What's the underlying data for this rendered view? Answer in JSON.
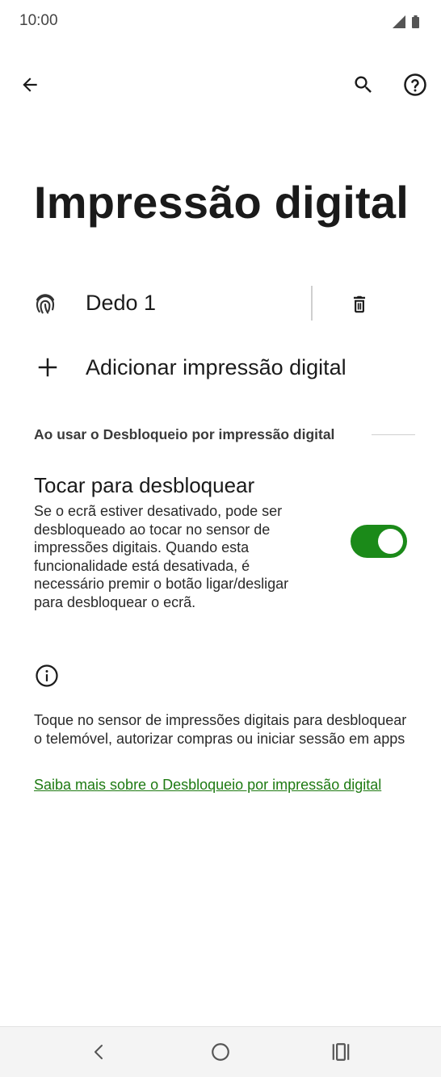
{
  "status_bar": {
    "time": "10:00",
    "icons": [
      "signal-icon",
      "battery-icon"
    ]
  },
  "app_bar": {
    "back_icon": "arrow-left-icon",
    "search_icon": "search-icon",
    "help_icon": "help-circle-icon"
  },
  "page": {
    "title": "Impressão digital"
  },
  "fingerprints": [
    {
      "label": "Dedo 1",
      "icon": "fingerprint-icon",
      "action_icon": "trash-icon"
    }
  ],
  "add_fingerprint": {
    "icon": "plus-icon",
    "label": "Adicionar impressão digital"
  },
  "section": {
    "header": "Ao usar o Desbloqueio por impressão digital"
  },
  "tap_to_unlock": {
    "title": "Tocar para desbloquear",
    "description": "Se o ecrã estiver desativado, pode ser desbloqueado ao tocar no sensor de impressões digitais. Quando esta funcionalidade está desativada, é necessário premir o botão ligar/desligar para desbloquear o ecrã.",
    "enabled": true
  },
  "info": {
    "icon": "info-icon",
    "text": "Toque no sensor de impressões digitais para desbloquear o telemóvel, autorizar compras ou iniciar sessão em apps",
    "link": "Saiba mais sobre o Desbloqueio por impressão digital"
  },
  "nav_bar": {
    "back_icon": "nav-back-icon",
    "home_icon": "nav-home-icon",
    "recents_icon": "nav-recents-icon"
  },
  "colors": {
    "accent": "#1b8a19",
    "link": "#1e7a12",
    "text": "#1b1b1b"
  }
}
